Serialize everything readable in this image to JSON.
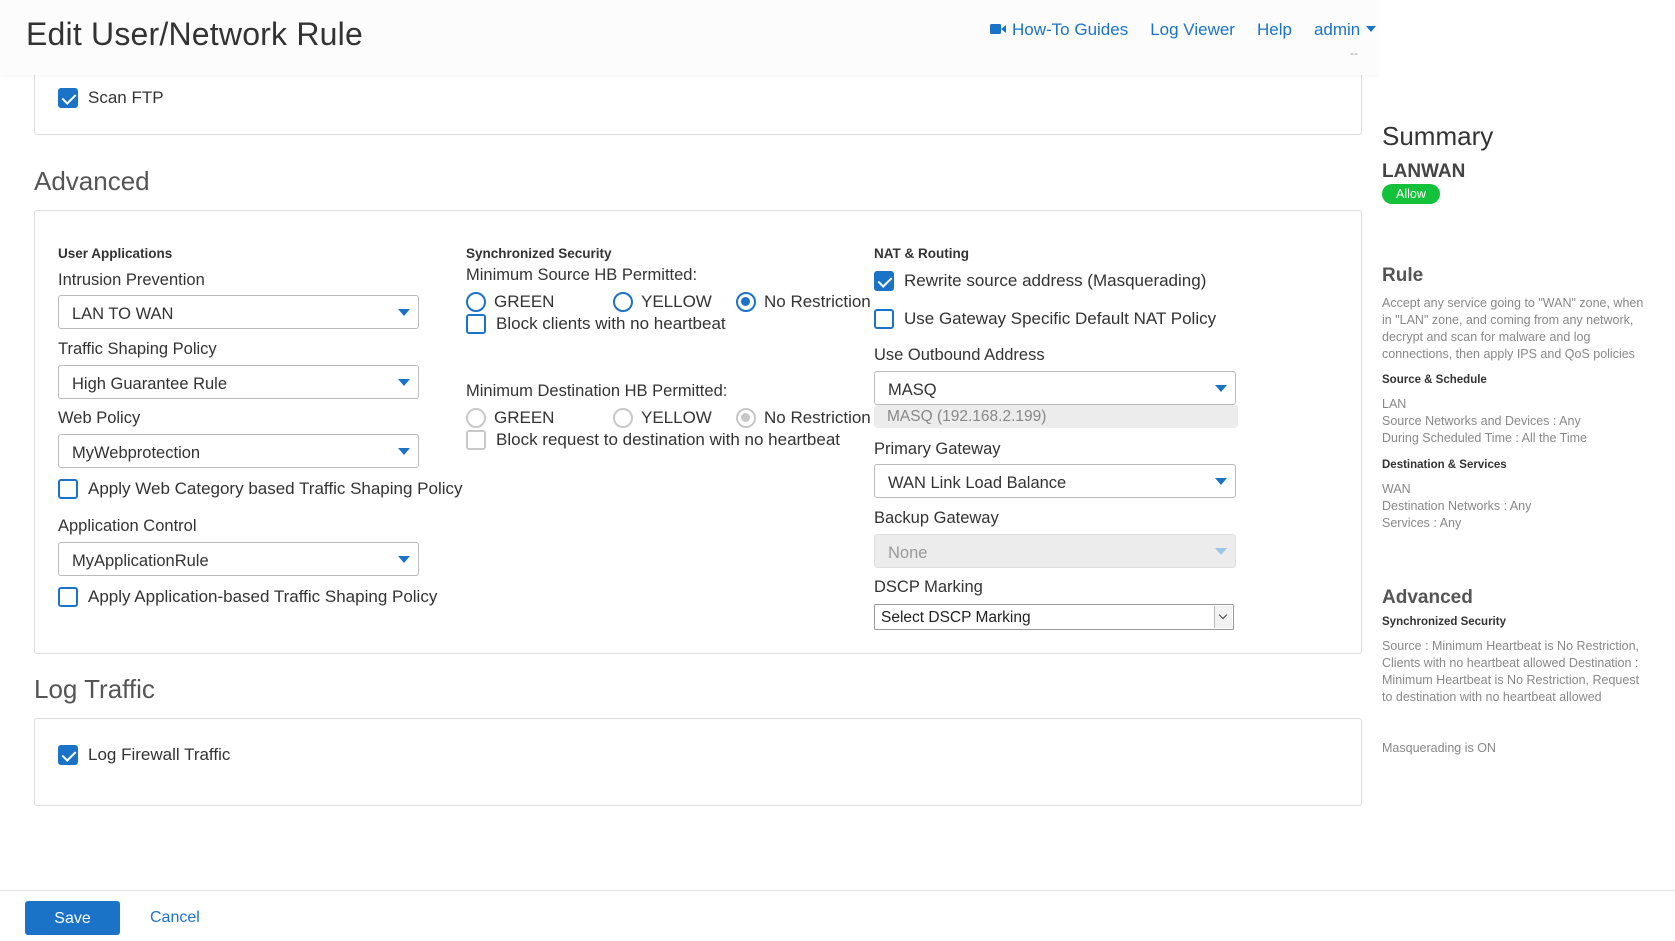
{
  "header": {
    "title": "Edit User/Network Rule",
    "links": {
      "howto": "How-To Guides",
      "logviewer": "Log Viewer",
      "help": "Help",
      "admin": "admin"
    },
    "sub": "--"
  },
  "scan": {
    "ftp_label": "Scan FTP",
    "ftp_checked": true
  },
  "advanced": {
    "title": "Advanced",
    "user_apps": {
      "heading": "User Applications",
      "ips_label": "Intrusion Prevention",
      "ips_value": "LAN TO WAN",
      "ts_label": "Traffic Shaping Policy",
      "ts_value": "High Guarantee Rule",
      "web_label": "Web Policy",
      "web_value": "MyWebprotection",
      "web_cat_label": "Apply Web Category based Traffic Shaping Policy",
      "app_label": "Application Control",
      "app_value": "MyApplicationRule",
      "app_ts_label": "Apply Application-based Traffic Shaping Policy"
    },
    "sync": {
      "heading": "Synchronized Security",
      "src_label": "Minimum Source HB Permitted:",
      "green": "GREEN",
      "yellow": "YELLOW",
      "none": "No Restriction",
      "block_clients": "Block clients with no heartbeat",
      "dst_label": "Minimum Destination HB Permitted:",
      "block_dst": "Block request to destination with no heartbeat"
    },
    "nat": {
      "heading": "NAT & Routing",
      "masq_label": "Rewrite source address (Masquerading)",
      "gw_nat_label": "Use Gateway Specific Default NAT Policy",
      "outbound_label": "Use Outbound Address",
      "outbound_value": "MASQ",
      "outbound_ip": "MASQ (192.168.2.199)",
      "primary_label": "Primary Gateway",
      "primary_value": "WAN Link Load Balance",
      "backup_label": "Backup Gateway",
      "backup_value": "None",
      "dscp_label": "DSCP Marking",
      "dscp_value": "Select DSCP Marking"
    }
  },
  "log": {
    "title": "Log Traffic",
    "fw_label": "Log Firewall Traffic"
  },
  "summary": {
    "title": "Summary",
    "name": "LANWAN",
    "badge": "Allow",
    "rule_title": "Rule",
    "rule_text": "Accept any service going to \"WAN\" zone, when in \"LAN\" zone, and coming from any network, decrypt and scan for malware and log connections, then apply IPS and QoS policies",
    "src_title": "Source & Schedule",
    "src_zone": "LAN",
    "src_nets": "Source Networks and Devices : Any",
    "src_time": "During Scheduled Time : All the Time",
    "dst_title": "Destination & Services",
    "dst_zone": "WAN",
    "dst_nets": "Destination Networks : Any",
    "dst_services": "Services : Any",
    "adv_title": "Advanced",
    "sync_title": "Synchronized Security",
    "sync_text": "Source : Minimum Heartbeat is No Restriction, Clients with no heartbeat allowed Destination : Minimum Heartbeat is No Restriction, Request to destination with no heartbeat allowed",
    "masq_text": "Masquerading is ON"
  },
  "footer": {
    "save": "Save",
    "cancel": "Cancel"
  }
}
